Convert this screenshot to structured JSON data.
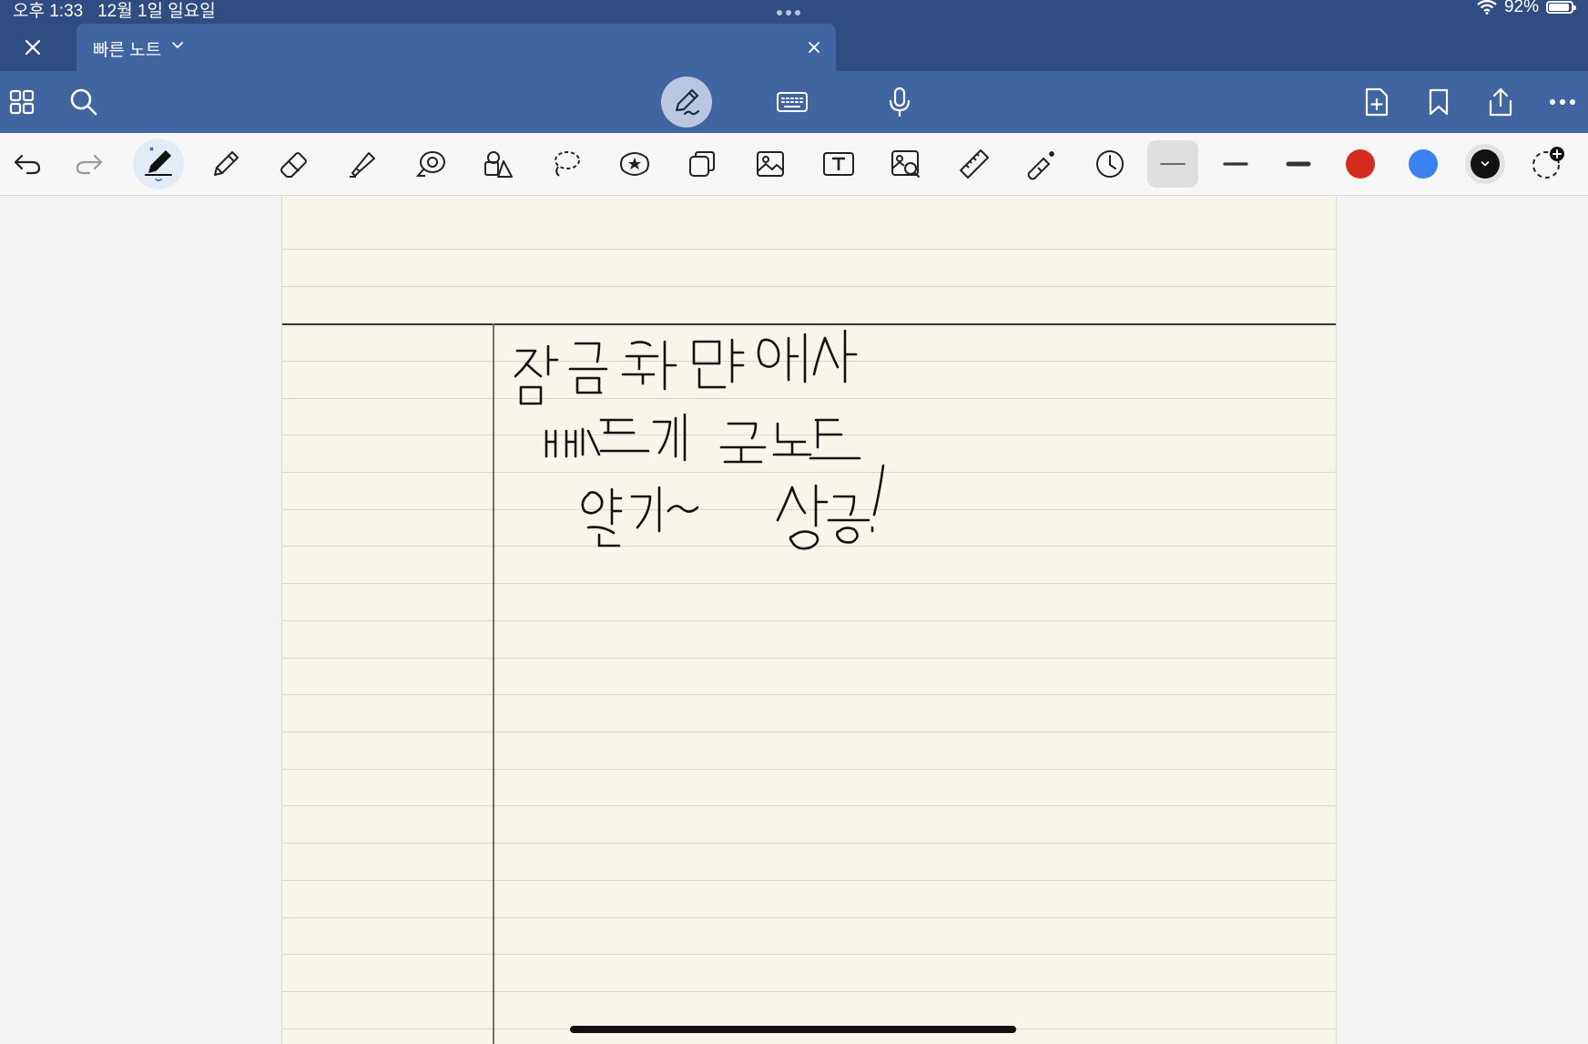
{
  "status": {
    "time": "오후 1:33",
    "date": "12월 1일 일요일",
    "battery_text": "92%",
    "battery_level": 0.92
  },
  "tab": {
    "title": "빠른 노트"
  },
  "note": {
    "handwriting_lines": [
      "잠금화면에서",
      "빠르게 퀵노트",
      "열기~ 성공!"
    ]
  },
  "colors": {
    "tab_bar": "#2f4d80",
    "toolbar": "#4165a1",
    "paper": "#f8f6ea",
    "swatch_red": "#d42a20",
    "swatch_blue": "#3b82f0",
    "swatch_black": "#111111"
  },
  "icons": {
    "main_toolbar": [
      "grid-icon",
      "search-icon",
      "handwriting-mode-icon",
      "keyboard-icon",
      "microphone-icon",
      "add-page-icon",
      "bookmark-icon",
      "share-icon",
      "more-icon"
    ],
    "tools": [
      "undo-icon",
      "redo-icon",
      "pen-icon",
      "pencil-icon",
      "eraser-icon",
      "highlighter-icon",
      "spray-icon",
      "shapes-icon",
      "lasso-icon",
      "sticker-icon",
      "elements-icon",
      "image-icon",
      "text-box-icon",
      "scan-icon",
      "ruler-icon",
      "laser-pointer-icon",
      "history-icon"
    ]
  }
}
